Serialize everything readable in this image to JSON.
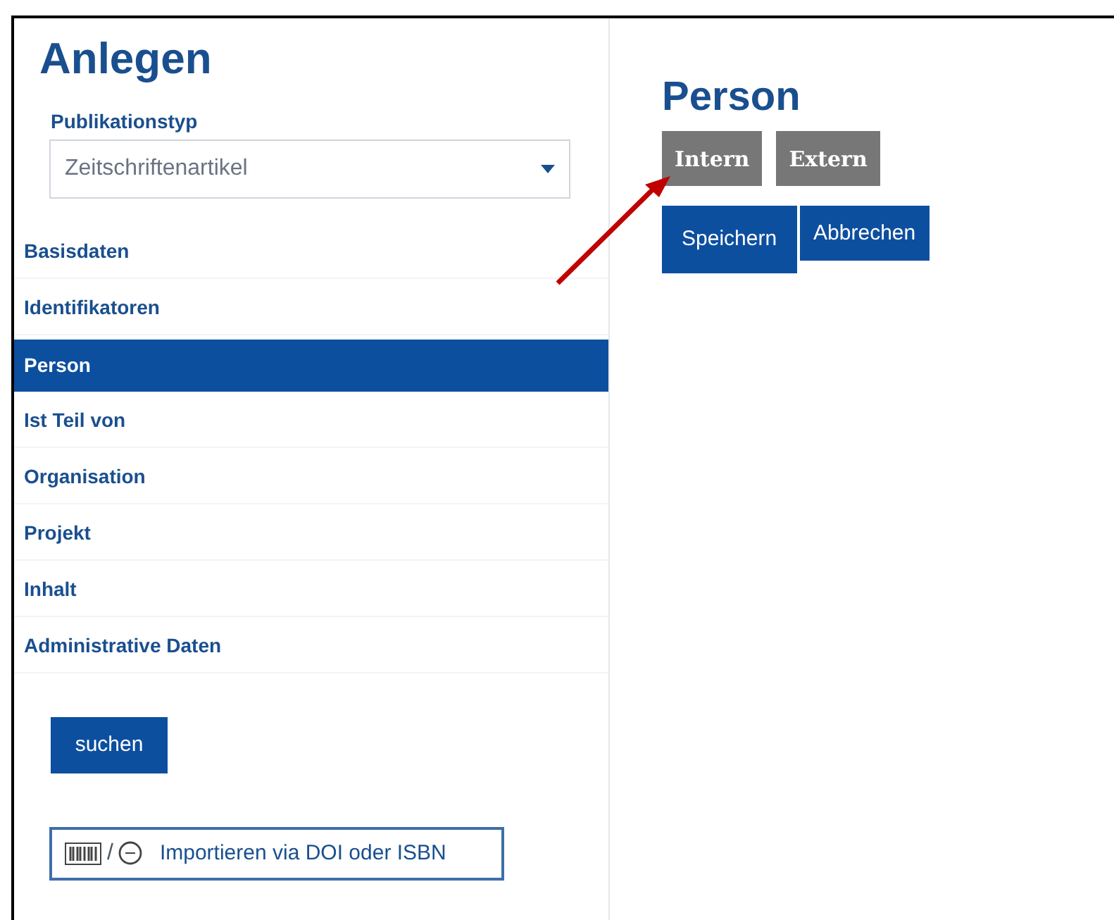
{
  "sidebar": {
    "title": "Anlegen",
    "field": {
      "label": "Publikationstyp",
      "value": "Zeitschriftenartikel"
    },
    "items": [
      {
        "label": "Basisdaten",
        "selected": false
      },
      {
        "label": "Identifikatoren",
        "selected": false
      },
      {
        "label": "Person",
        "selected": true
      },
      {
        "label": "Ist Teil von",
        "selected": false
      },
      {
        "label": "Organisation",
        "selected": false
      },
      {
        "label": "Projekt",
        "selected": false
      },
      {
        "label": "Inhalt",
        "selected": false
      },
      {
        "label": "Administrative Daten",
        "selected": false
      }
    ],
    "search_button": "suchen",
    "import_separator": "/",
    "import_button": "Importieren via DOI oder ISBN"
  },
  "main": {
    "title": "Person",
    "type_buttons": [
      "Intern",
      "Extern"
    ],
    "actions": [
      "Speichern",
      "Abbrechen"
    ]
  }
}
